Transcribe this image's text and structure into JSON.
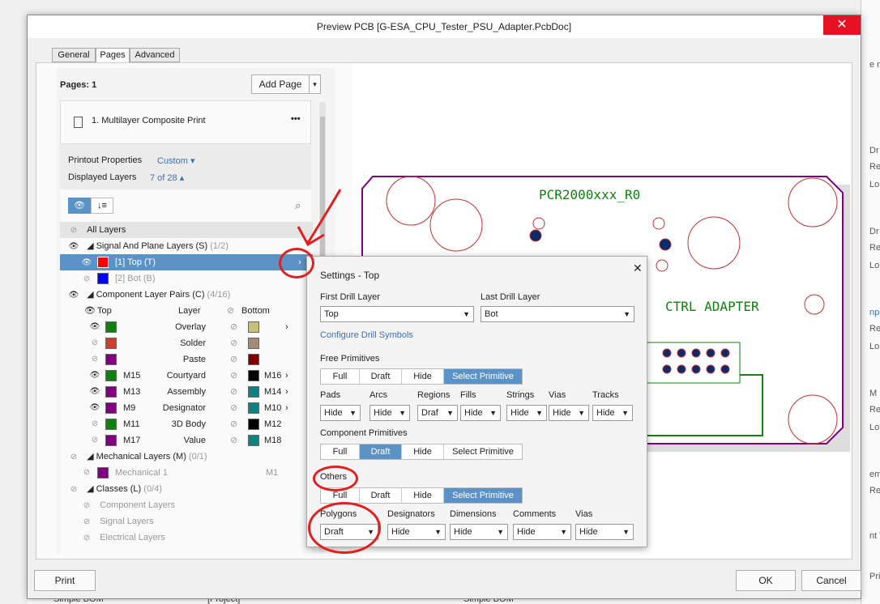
{
  "window": {
    "title": "Preview PCB [G-ESA_CPU_Tester_PSU_Adapter.PcbDoc]",
    "close": "✕"
  },
  "tabs": [
    "General",
    "Pages",
    "Advanced"
  ],
  "pages": {
    "label": "Pages: 1",
    "add_page": "Add Page",
    "page_item": "1.  Multilayer Composite Print",
    "more": "•••"
  },
  "printout": {
    "label": "Printout Properties",
    "value": "Custom ▾",
    "layers_label": "Displayed Layers",
    "layers_value": "7 of 28 ▴"
  },
  "layers": {
    "all": "All Layers",
    "signal_group": "Signal And Plane Layers (S)",
    "signal_count": "(1/2)",
    "top": "[1] Top (T)",
    "bot": "[2] Bot (B)",
    "pairs_group": "Component Layer Pairs (C)",
    "pairs_count": "(4/16)",
    "col_top": "Top",
    "col_layer": "Layer",
    "col_bottom": "Bottom",
    "pairs": [
      {
        "top": "",
        "layer": "Overlay",
        "bottom": "",
        "tc": "#108010",
        "bc": "#c8c078"
      },
      {
        "top": "",
        "layer": "Solder",
        "bottom": "",
        "tc": "#c84030",
        "bc": "#a88878"
      },
      {
        "top": "",
        "layer": "Paste",
        "bottom": "",
        "tc": "#800080",
        "bc": "#800000"
      },
      {
        "top": "M15",
        "layer": "Courtyard",
        "bottom": "M16",
        "tc": "#108010",
        "bc": "#000000"
      },
      {
        "top": "M13",
        "layer": "Assembly",
        "bottom": "M14",
        "tc": "#800080",
        "bc": "#108080"
      },
      {
        "top": "M9",
        "layer": "Designator",
        "bottom": "M10",
        "tc": "#800080",
        "bc": "#108080"
      },
      {
        "top": "M11",
        "layer": "3D Body",
        "bottom": "M12",
        "tc": "#108010",
        "bc": "#000000"
      },
      {
        "top": "M17",
        "layer": "Value",
        "bottom": "M18",
        "tc": "#800080",
        "bc": "#108080"
      }
    ],
    "mech_group": "Mechanical Layers (M)",
    "mech_count": "(0/1)",
    "mech1": "Mechanical 1",
    "mech1_code": "M1",
    "classes_group": "Classes (L)",
    "classes_count": "(0/4)",
    "classes": [
      "Component Layers",
      "Signal Layers",
      "Electrical Layers"
    ]
  },
  "settings": {
    "title": "Settings - Top",
    "first_drill_label": "First Drill Layer",
    "first_drill": "Top",
    "last_drill_label": "Last Drill Layer",
    "last_drill": "Bot",
    "configure": "Configure Drill Symbols",
    "free_label": "Free Primitives",
    "free_opts": [
      "Full",
      "Draft",
      "Hide",
      "Select Primitive"
    ],
    "prim_labels": [
      "Pads",
      "Arcs",
      "Regions",
      "Fills",
      "Strings",
      "Vias",
      "Tracks"
    ],
    "prim_values": [
      "Hide",
      "Hide",
      "Draf",
      "Hide",
      "Hide",
      "Hide",
      "Hide"
    ],
    "comp_label": "Component Primitives",
    "comp_opts": [
      "Full",
      "Draft",
      "Hide",
      "Select Primitive"
    ],
    "others_label": "Others",
    "others_opts": [
      "Full",
      "Draft",
      "Hide",
      "Select Primitive"
    ],
    "other_labels": [
      "Polygons",
      "Designators",
      "Dimensions",
      "Comments",
      "Vias"
    ],
    "other_values": [
      "Draft",
      "Hide",
      "Hide",
      "Hide",
      "Hide"
    ]
  },
  "pcb": {
    "title": "PCR2000xxx_R0",
    "sub": "CTRL ADAPTER"
  },
  "buttons": {
    "print": "Print",
    "ok": "OK",
    "cancel": "Cancel"
  },
  "background": {
    "row_name": "Simple BOM",
    "row_type": "[Project]",
    "row_name2": "Simple BOM",
    "right": [
      "e m",
      "Dr",
      "Re",
      "Lo",
      "Dr",
      "Re",
      "Lo",
      "npo",
      "Re",
      "Lo",
      "M",
      "Re",
      "Lo",
      "em",
      "Re",
      "nt T",
      "Pri"
    ]
  },
  "colors": {
    "accent": "#5b93c6",
    "selection": "#5b93c6",
    "annotation": "#e02020",
    "pcb_outline": "#800080",
    "pcb_circle": "#c03030",
    "pcb_text": "#108010"
  }
}
